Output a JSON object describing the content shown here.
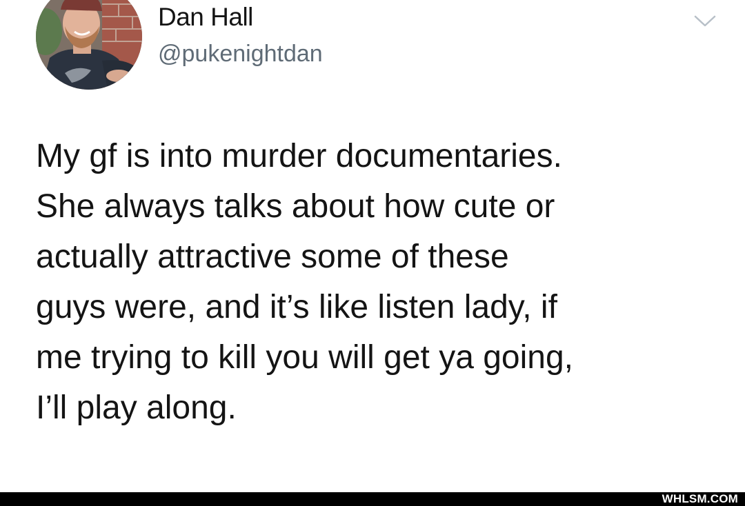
{
  "tweet": {
    "author": {
      "display_name": "Dan Hall",
      "handle": "@pukenightdan"
    },
    "text_lines": [
      "My gf is into murder documentaries.",
      "She always talks about how cute or",
      "actually attractive some of these",
      "guys were, and it’s like listen lady, if",
      "me trying to kill you will get ya going,",
      "I’ll play along."
    ],
    "menu_icon": "chevron-down-icon"
  },
  "footer": {
    "watermark": "WHLSM.COM",
    "background": "#000000",
    "text_color": "#ffffff"
  },
  "colors": {
    "text": "#141414",
    "handle": "#5f6b76",
    "chevron": "#b8c0c8",
    "background": "#ffffff"
  }
}
